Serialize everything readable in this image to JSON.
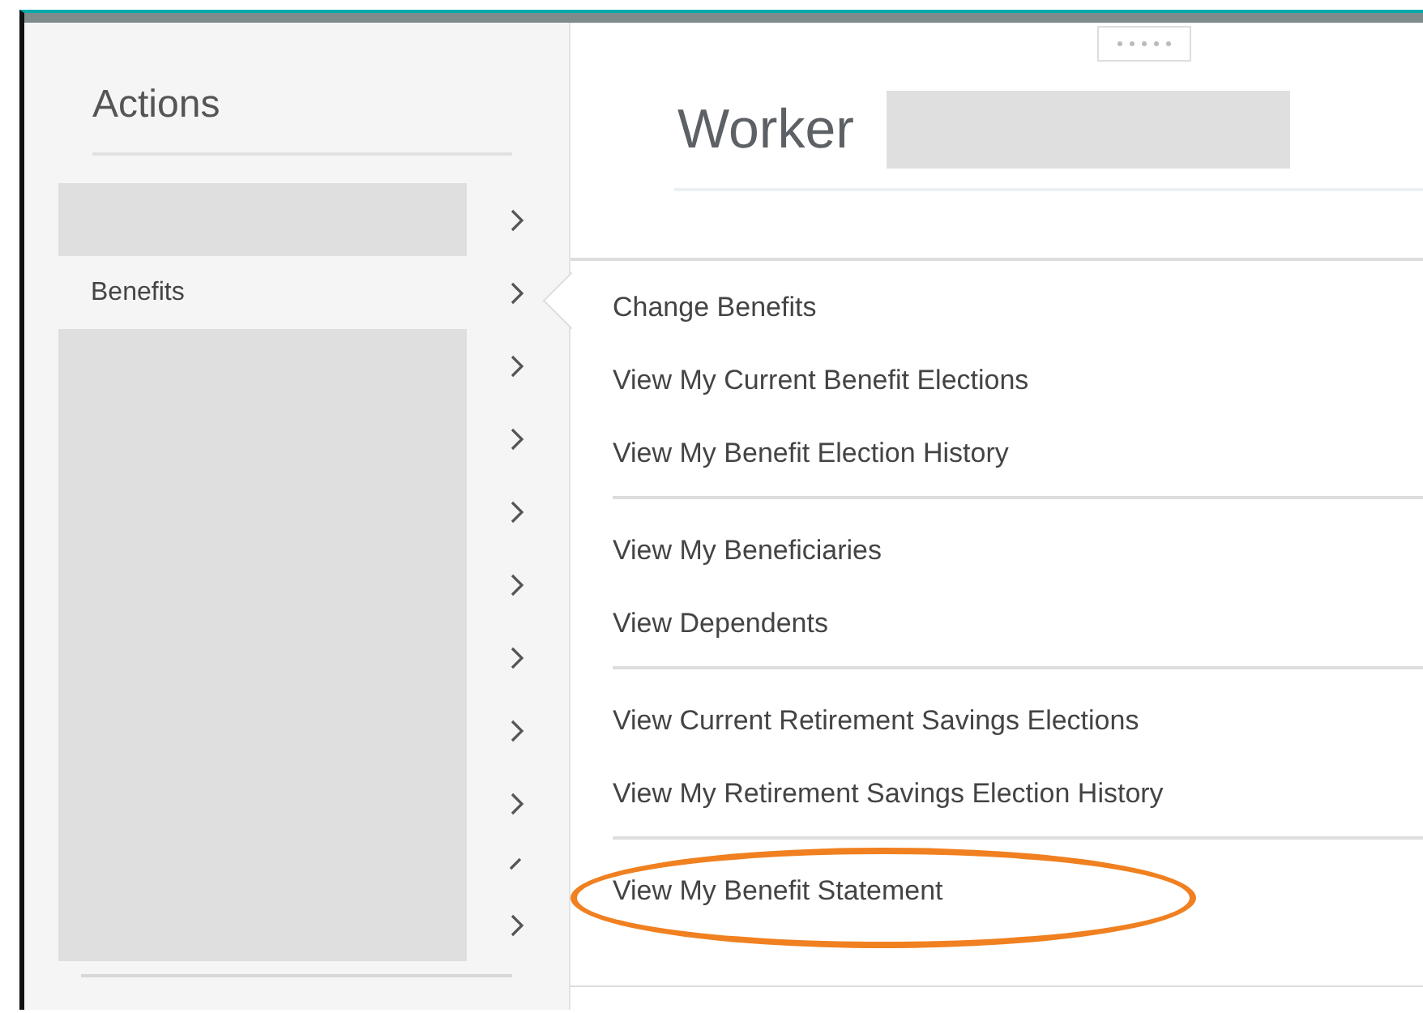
{
  "actions_panel": {
    "title": "Actions",
    "rows": [
      {
        "kind": "redacted"
      },
      {
        "kind": "item",
        "label": "Benefits",
        "selected": true
      },
      {
        "kind": "redacted"
      },
      {
        "kind": "redacted"
      },
      {
        "kind": "redacted"
      },
      {
        "kind": "redacted"
      },
      {
        "kind": "redacted"
      },
      {
        "kind": "redacted"
      },
      {
        "kind": "redacted"
      },
      {
        "kind": "redacted_short"
      },
      {
        "kind": "redacted"
      }
    ]
  },
  "header": {
    "title": "Worker"
  },
  "submenu": {
    "sections": [
      [
        {
          "label": "Change Benefits",
          "circled": false
        },
        {
          "label": "View My Current Benefit Elections",
          "circled": false
        },
        {
          "label": "View My Benefit Election History",
          "circled": false
        }
      ],
      [
        {
          "label": "View My Beneficiaries",
          "circled": false
        },
        {
          "label": "View Dependents",
          "circled": false
        }
      ],
      [
        {
          "label": "View Current Retirement Savings Elections",
          "circled": false
        },
        {
          "label": "View My Retirement Savings Election History",
          "circled": false
        }
      ],
      [
        {
          "label": "View My Benefit Statement",
          "circled": true
        }
      ]
    ]
  }
}
